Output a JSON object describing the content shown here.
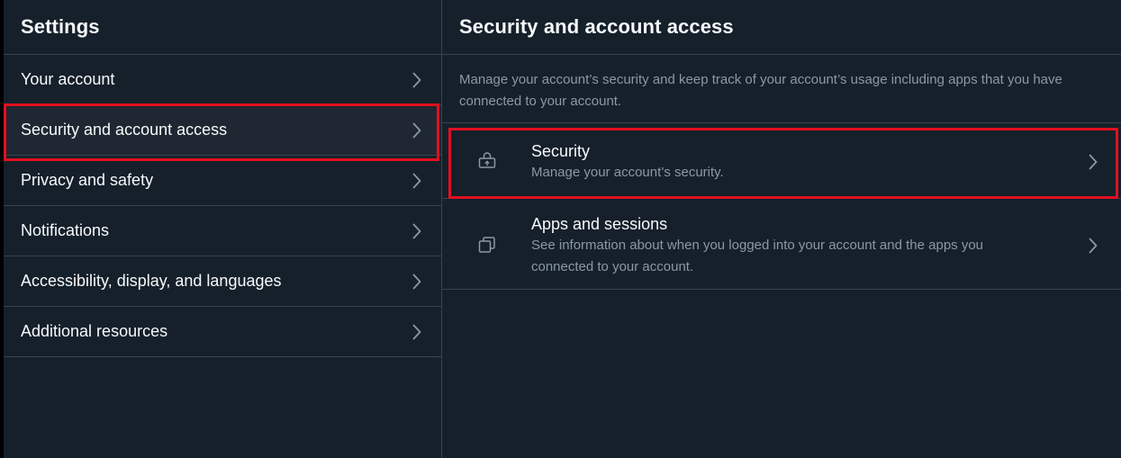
{
  "settings": {
    "title": "Settings",
    "items": [
      {
        "label": "Your account"
      },
      {
        "label": "Security and account access"
      },
      {
        "label": "Privacy and safety"
      },
      {
        "label": "Notifications"
      },
      {
        "label": "Accessibility, display, and languages"
      },
      {
        "label": "Additional resources"
      }
    ],
    "active_index": 1
  },
  "detail": {
    "title": "Security and account access",
    "description": "Manage your account’s security and keep track of your account’s usage including apps that you have connected to your account.",
    "options": [
      {
        "title": "Security",
        "subtitle": "Manage your account’s security.",
        "icon": "lock-icon"
      },
      {
        "title": "Apps and sessions",
        "subtitle": "See information about when you logged into your account and the apps you connected to your account.",
        "icon": "apps-icon"
      }
    ]
  },
  "colors": {
    "background": "#15202b",
    "active_row": "#1e2732",
    "divider": "#38444d",
    "text_primary": "#f7f9f9",
    "text_secondary": "#8b98a5",
    "highlight_outline": "#e0101e"
  }
}
